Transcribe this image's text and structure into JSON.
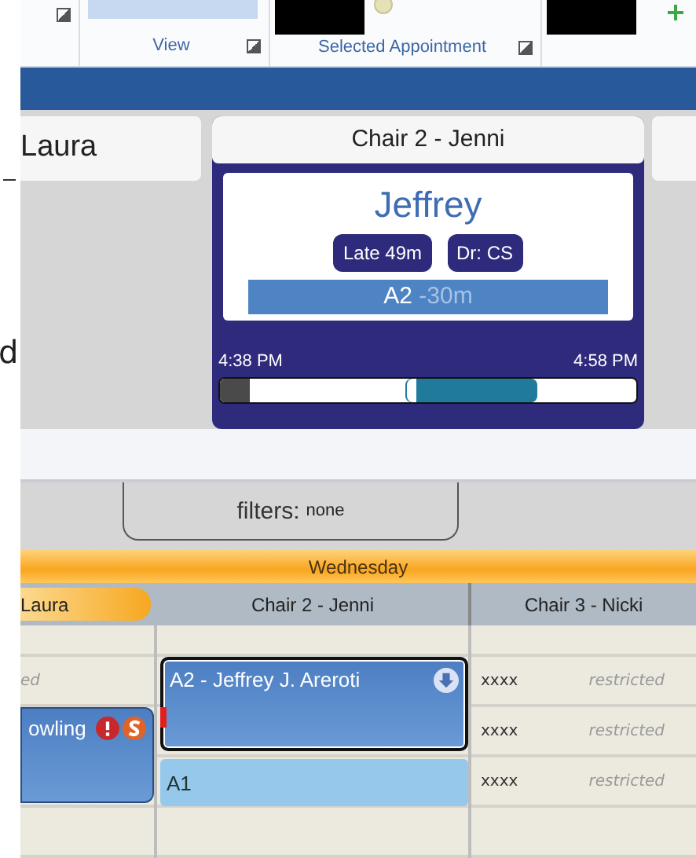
{
  "left_edge": {
    "text": "d"
  },
  "ribbon": {
    "groups": [
      {
        "label": "View"
      },
      {
        "label": "Selected Appointment"
      }
    ]
  },
  "side_card": {
    "title": "Laura"
  },
  "focus_card": {
    "title": "Chair 2 - Jenni",
    "patient": "Jeffrey",
    "badges": [
      "Late 49m",
      "Dr: CS"
    ],
    "code": "A2",
    "duration": "-30m",
    "start_time": "4:38 PM",
    "end_time": "4:58 PM",
    "timeline": {
      "level": 0.07
    }
  },
  "filters": {
    "label": "filters:",
    "value": "none"
  },
  "day": "Wednesday",
  "columns": [
    {
      "title": "Laura",
      "selected": true
    },
    {
      "title": "Chair 2 - Jenni",
      "selected": false
    },
    {
      "title": "Chair 3 - Nicki",
      "selected": false
    }
  ],
  "laura_cells": [
    "ed"
  ],
  "chair3_cells": [
    {
      "code": "xxxx",
      "note": "restricted"
    },
    {
      "code": "xxxx",
      "note": "restricted"
    },
    {
      "code": "xxxx",
      "note": "restricted"
    }
  ],
  "appointments": [
    {
      "kind": "booked",
      "title": "owling",
      "selected": false,
      "alerts": true
    },
    {
      "kind": "booked",
      "title": "A2 - Jeffrey J. Areroti",
      "selected": true,
      "alerts": false
    },
    {
      "kind": "placeholder",
      "title": "A1",
      "selected": false,
      "alerts": false
    }
  ]
}
